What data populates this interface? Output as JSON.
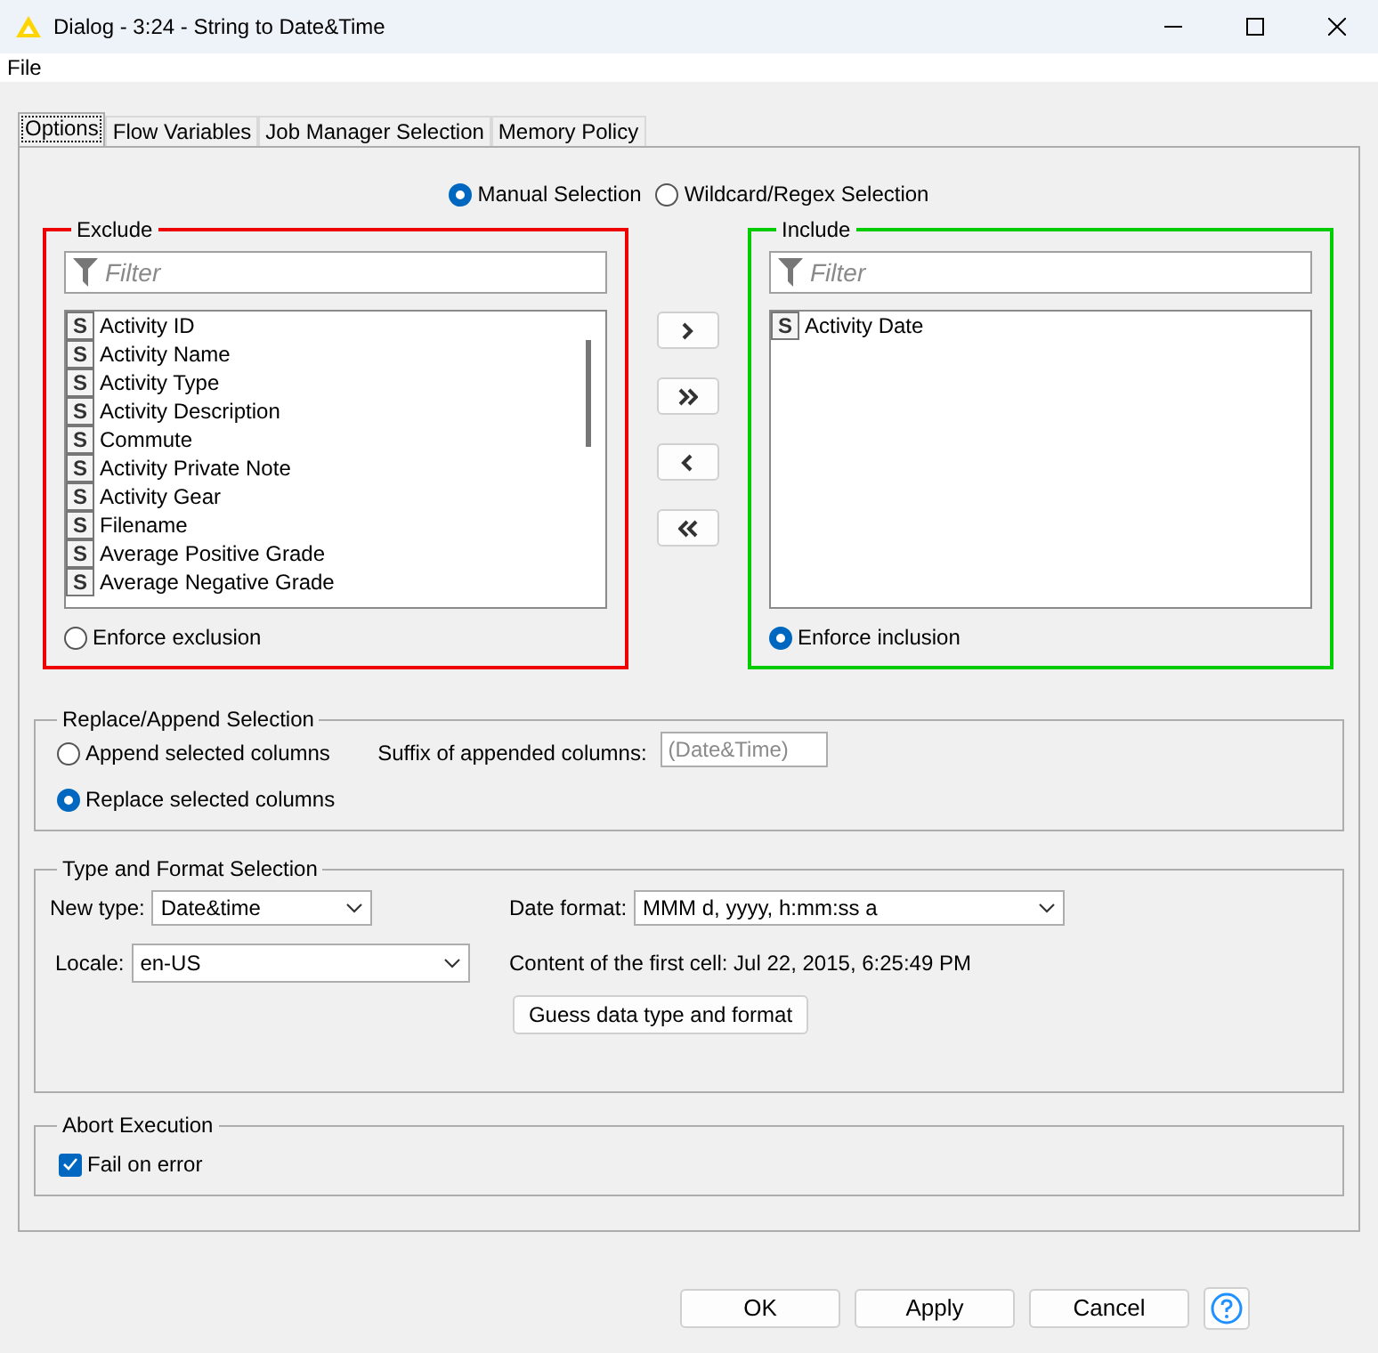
{
  "window": {
    "title": "Dialog - 3:24 - String to Date&Time"
  },
  "menu": [
    "File"
  ],
  "tabs": [
    {
      "label": "Options",
      "selected": true
    },
    {
      "label": "Flow Variables",
      "selected": false
    },
    {
      "label": "Job Manager Selection",
      "selected": false
    },
    {
      "label": "Memory Policy",
      "selected": false
    }
  ],
  "selection_mode": [
    {
      "label": "Manual Selection",
      "selected": true
    },
    {
      "label": "Wildcard/Regex Selection",
      "selected": false
    }
  ],
  "exclude": {
    "title": "Exclude",
    "color": "#ee0000",
    "filter_placeholder": "Filter",
    "columns": [
      {
        "type": "S",
        "name": "Activity ID"
      },
      {
        "type": "S",
        "name": "Activity Name"
      },
      {
        "type": "S",
        "name": "Activity Type"
      },
      {
        "type": "S",
        "name": "Activity Description"
      },
      {
        "type": "S",
        "name": "Commute"
      },
      {
        "type": "S",
        "name": "Activity Private Note"
      },
      {
        "type": "S",
        "name": "Activity Gear"
      },
      {
        "type": "S",
        "name": "Filename"
      },
      {
        "type": "S",
        "name": "Average Positive Grade"
      },
      {
        "type": "S",
        "name": "Average Negative Grade"
      }
    ],
    "enforce": {
      "label": "Enforce exclusion",
      "selected": false
    }
  },
  "include": {
    "title": "Include",
    "color": "#00cc00",
    "filter_placeholder": "Filter",
    "columns": [
      {
        "type": "S",
        "name": "Activity Date"
      }
    ],
    "enforce": {
      "label": "Enforce inclusion",
      "selected": true
    }
  },
  "replace_append": {
    "title": "Replace/Append Selection",
    "options": [
      {
        "label": "Append selected columns",
        "selected": false
      },
      {
        "label": "Replace selected columns",
        "selected": true
      }
    ],
    "suffix_label": "Suffix of appended columns:",
    "suffix_value": "(Date&Time)",
    "suffix_disabled": true
  },
  "type_format": {
    "title": "Type and Format Selection",
    "new_type_label": "New type:",
    "new_type": "Date&time",
    "date_format_label": "Date format:",
    "date_format": "MMM d, yyyy, h:mm:ss a",
    "locale_label": "Locale:",
    "locale": "en-US",
    "first_cell": "Content of the first cell: Jul 22, 2015, 6:25:49 PM",
    "guess_button": "Guess data type and format"
  },
  "abort": {
    "title": "Abort Execution",
    "fail_on_error": {
      "label": "Fail on error",
      "checked": true
    }
  },
  "buttons": [
    "OK",
    "Apply",
    "Cancel"
  ]
}
